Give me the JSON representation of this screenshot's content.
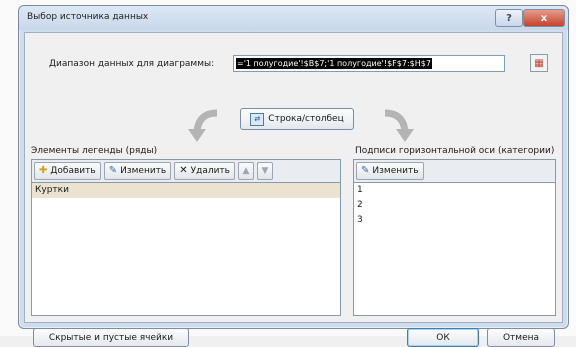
{
  "dialog": {
    "title": "Выбор источника данных",
    "help_glyph": "?",
    "close_glyph": "x"
  },
  "range": {
    "label": "Диапазон данных для диаграммы:",
    "value": "='1 полугодие'!$B$7;'1 полугодие'!$F$7:$H$7"
  },
  "swap_button": {
    "label": "Строка/столбец"
  },
  "legend": {
    "heading": "Элементы легенды (ряды)",
    "add_label": "Добавить",
    "edit_label": "Изменить",
    "delete_label": "Удалить",
    "items": [
      "Куртки"
    ]
  },
  "axis": {
    "heading": "Подписи горизонтальной оси (категории)",
    "edit_label": "Изменить",
    "items": [
      "1",
      "2",
      "3"
    ]
  },
  "footer": {
    "hidden_cells_label": "Скрытые и пустые ячейки",
    "ok_label": "ОК",
    "cancel_label": "Отмена"
  },
  "colors": {
    "title_bar": "#c8d7ea",
    "close_button": "#c2442c",
    "selection": "#ebe3cf"
  }
}
